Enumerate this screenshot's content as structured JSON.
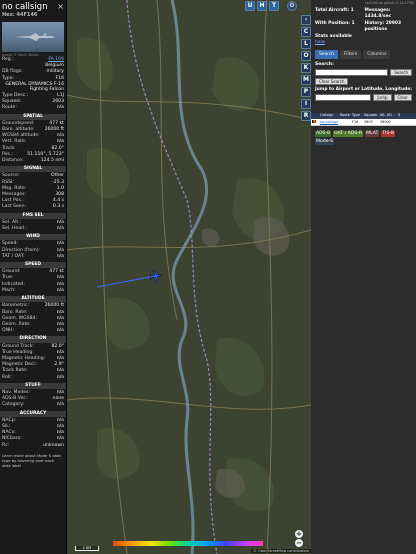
{
  "left": {
    "title": "no callsign",
    "hex": "Hex: 44F146",
    "close": "×",
    "image_credit": "Image © Kevin Bollon",
    "fields": [
      {
        "k": "Reg.:",
        "v": "FA-106",
        "link": true
      },
      {
        "k": "",
        "v": "Belgium"
      },
      {
        "k": "DB flags:",
        "v": "military"
      },
      {
        "k": "Type:",
        "v": "F16"
      }
    ],
    "type_full": "GENERAL DYNAMICS F-16 Fighting Falcon",
    "fields2": [
      {
        "k": "Type Desc.:",
        "v": "L1J"
      },
      {
        "k": "Squawk:",
        "v": "2603"
      },
      {
        "k": "Route:",
        "v": "n/a"
      }
    ],
    "sections": [
      {
        "title": "SPATIAL",
        "rows": [
          {
            "k": "Groundspeed:",
            "v": "477 kt"
          },
          {
            "k": "Baro. altitude:",
            "v": "26000 ft"
          },
          {
            "k": "WGS84 altitude:",
            "v": "n/a"
          },
          {
            "k": "Vert. Rate:",
            "v": "n/a"
          },
          {
            "k": "Track:",
            "v": "82.0°"
          },
          {
            "k": "Pos.:",
            "v": "51.110°, 5.723°"
          },
          {
            "k": "Distance:",
            "v": "124.5 nmi"
          }
        ]
      },
      {
        "title": "SIGNAL",
        "rows": [
          {
            "k": "Source:",
            "v": "Other"
          },
          {
            "k": "RSSI:",
            "v": "-25.3"
          },
          {
            "k": "Msg. Rate:",
            "v": "1.0"
          },
          {
            "k": "Messages:",
            "v": "308"
          },
          {
            "k": "Last Pos.:",
            "v": "4.4 s"
          },
          {
            "k": "Last Seen:",
            "v": "0.3 s"
          }
        ]
      },
      {
        "title": "FMS SEL",
        "rows": [
          {
            "k": "Sel. Alt.:",
            "v": "n/a"
          },
          {
            "k": "Sel. Head.:",
            "v": "n/a"
          }
        ]
      },
      {
        "title": "WIND",
        "rows": [
          {
            "k": "Speed:",
            "v": "n/a"
          },
          {
            "k": "Direction (from):",
            "v": "n/a"
          },
          {
            "k": "TAT / OAT:",
            "v": "n/a"
          }
        ]
      },
      {
        "title": "SPEED",
        "rows": [
          {
            "k": "Ground:",
            "v": "477 kt"
          },
          {
            "k": "True:",
            "v": "n/a"
          },
          {
            "k": "Indicated:",
            "v": "n/a"
          },
          {
            "k": "Mach:",
            "v": "n/a"
          }
        ]
      },
      {
        "title": "ALTITUDE",
        "rows": [
          {
            "k": "Barometric:",
            "v": "26000 ft"
          },
          {
            "k": "Baro. Rate:",
            "v": "n/a"
          },
          {
            "k": "Geom. WGS84:",
            "v": "n/a"
          },
          {
            "k": "Geom. Rate:",
            "v": "n/a"
          },
          {
            "k": "QNH:",
            "v": "n/a"
          }
        ]
      },
      {
        "title": "DIRECTION",
        "rows": [
          {
            "k": "Ground Track:",
            "v": "82.0°"
          },
          {
            "k": "True Heading:",
            "v": "n/a"
          },
          {
            "k": "Magnetic Heading:",
            "v": "n/a"
          },
          {
            "k": "Magnetic Decl.:",
            "v": "2.9°"
          },
          {
            "k": "Track Rate:",
            "v": "n/a"
          },
          {
            "k": "Roll:",
            "v": "n/a"
          }
        ]
      },
      {
        "title": "STUFF",
        "rows": [
          {
            "k": "Nav. Modes:",
            "v": "n/a"
          },
          {
            "k": "ADS-B Ver.:",
            "v": "none"
          },
          {
            "k": "Category:",
            "v": "n/a"
          }
        ]
      },
      {
        "title": "ACCURACY",
        "rows": [
          {
            "k": "NACp:",
            "v": "n/a"
          },
          {
            "k": "SIL:",
            "v": "n/a"
          },
          {
            "k": "NACv:",
            "v": "n/a"
          },
          {
            "k": "NICbaro:",
            "v": "n/a"
          },
          {
            "k": "Rc:",
            "v": "unknown"
          }
        ]
      }
    ],
    "footnote": "Learn more about Mode S data type by hovering over each data label"
  },
  "map": {
    "top_buttons": [
      "U",
      "H",
      "T"
    ],
    "side_buttons": [
      "C",
      "L",
      "O",
      "K",
      "M",
      "P",
      "I",
      "R"
    ],
    "scale_label": "2 NM",
    "attribution": "© OpenStreetMap contributors",
    "zoom_in": "+",
    "zoom_out": "−",
    "aircraft_color": "#3b6cff",
    "land_color": "#3c4330"
  },
  "right": {
    "version": "tar1090 on github (3.14.1739)",
    "stats": {
      "total_label": "Total Aircraft: 1",
      "messages_label": "Messages: 1434.8/sec",
      "position_label": "With Position: 1",
      "history_label": "History: 29903 positions",
      "stats_label": "Stats available",
      "stats_link": "here"
    },
    "tabs": [
      "Search",
      "Filters",
      "Columns"
    ],
    "search_label": "Search:",
    "search_button": "Search",
    "clear_button": "Clear Search",
    "jump_label": "Jump to Airport or Latitude, Longitude:",
    "jump_button": "Jump",
    "clear2": "Clear",
    "table_headers": [
      "",
      "Callsign",
      "Route",
      "Type",
      "Squawk",
      "Alt. (ft)",
      "S"
    ],
    "table_row": {
      "callsign": "no callsign",
      "route": "",
      "type": "F16",
      "squawk": "2603",
      "alt": "26000",
      "s": ""
    },
    "badges": [
      "ADS-B",
      "UAT / ADS-R",
      "MLAT",
      "TIS-B",
      "Mode-S"
    ]
  }
}
